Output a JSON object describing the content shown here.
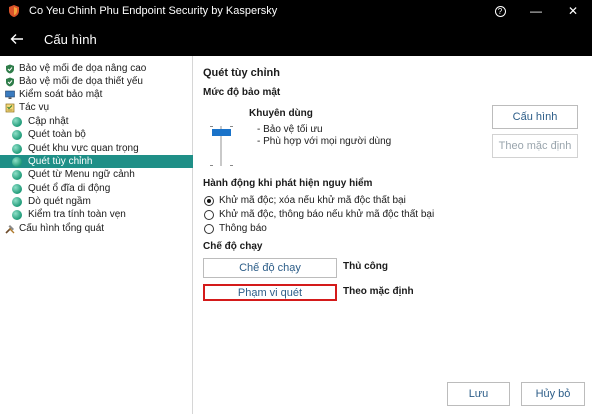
{
  "window": {
    "title": "Co Yeu Chinh Phu Endpoint Security by Kaspersky",
    "help_glyph": "?",
    "minimize_glyph": "—",
    "close_glyph": "✕"
  },
  "header": {
    "title": "Cấu hình"
  },
  "sidebar": {
    "items": [
      {
        "label": "Bảo vệ mối đe dọa nâng cao",
        "icon": "shield-icon",
        "selected": false
      },
      {
        "label": "Bảo vệ mối đe dọa thiết yếu",
        "icon": "shield-icon",
        "selected": false
      },
      {
        "label": "Kiểm soát bảo mật",
        "icon": "monitor-icon",
        "selected": false
      },
      {
        "label": "Tác vụ",
        "icon": "tasks-icon",
        "selected": false
      },
      {
        "label": "Cập nhật",
        "icon": "dot-icon",
        "selected": false
      },
      {
        "label": "Quét toàn bộ",
        "icon": "dot-icon",
        "selected": false
      },
      {
        "label": "Quét khu vực quan trọng",
        "icon": "dot-icon",
        "selected": false
      },
      {
        "label": "Quét tùy chỉnh",
        "icon": "dot-icon",
        "selected": true
      },
      {
        "label": "Quét từ Menu ngữ cảnh",
        "icon": "dot-icon",
        "selected": false
      },
      {
        "label": "Quét ổ đĩa di động",
        "icon": "dot-icon",
        "selected": false
      },
      {
        "label": "Dò quét ngầm",
        "icon": "dot-icon",
        "selected": false
      },
      {
        "label": "Kiểm tra tính toàn vẹn",
        "icon": "dot-icon",
        "selected": false
      },
      {
        "label": "Cấu hình tổng quát",
        "icon": "tools-icon",
        "selected": false
      }
    ]
  },
  "main": {
    "title": "Quét tùy chỉnh",
    "security_level": {
      "heading": "Mức độ bảo mật",
      "level_name": "Khuyên dùng",
      "desc1": "- Bảo vệ tối ưu",
      "desc2": "- Phù hợp với mọi người dùng",
      "configure_button": "Cấu hình",
      "default_button": "Theo mặc định"
    },
    "action": {
      "heading": "Hành động khi phát hiện nguy hiểm",
      "options": [
        {
          "label": "Khử mã độc; xóa nếu khử mã độc thất bại",
          "checked": true
        },
        {
          "label": "Khử mã độc, thông báo nếu khử mã độc thất bại",
          "checked": false
        },
        {
          "label": "Thông báo",
          "checked": false
        }
      ]
    },
    "run_mode": {
      "heading": "Chế độ chạy",
      "schedule_button": "Chế độ chạy",
      "schedule_value": "Thủ công",
      "scope_button": "Phạm vi quét",
      "scope_value": "Theo mặc định"
    },
    "save_button": "Lưu",
    "cancel_button": "Hủy bỏ"
  },
  "colors": {
    "accent": "#1f8f87",
    "focus": "#d41a1a",
    "slider": "#1a73c9"
  }
}
